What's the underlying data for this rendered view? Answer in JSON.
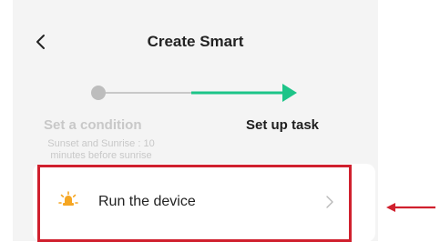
{
  "header": {
    "title": "Create Smart",
    "back_icon": "chevron-left-icon"
  },
  "steps": [
    {
      "label": "Set a condition",
      "description": "Sunset and Sunrise : 10 minutes before sunrise",
      "state": "completed"
    },
    {
      "label": "Set up task",
      "state": "active"
    }
  ],
  "task": {
    "label": "Run the device",
    "icon": "lightbulb-icon",
    "chevron_icon": "chevron-right-icon"
  },
  "colors": {
    "accent": "#1dc488",
    "inactive": "#c8c8c8",
    "highlight": "#d0202e",
    "icon": "#f5a623"
  }
}
